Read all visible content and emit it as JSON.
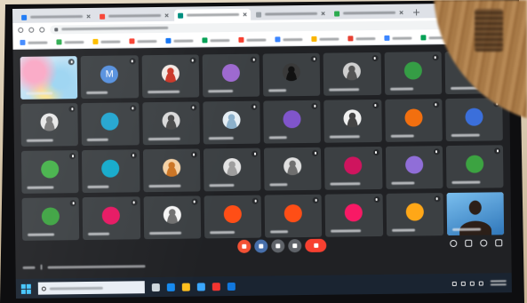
{
  "browser": {
    "tabs": [
      {
        "favicon_color": "#1a73e8",
        "active": false
      },
      {
        "favicon_color": "#ea4335",
        "active": false
      },
      {
        "favicon_color": "#00897b",
        "active": true
      },
      {
        "favicon_color": "#9aa0a6",
        "active": false
      },
      {
        "favicon_color": "#34a853",
        "active": false
      }
    ],
    "extension_colors": [
      "#ea4335",
      "#5f6368",
      "#1a73e8",
      "#ea4335",
      "#5f6368"
    ],
    "bookmark_colors": [
      "#4285f4",
      "#34a853",
      "#fbbc05",
      "#ea4335",
      "#1a73e8",
      "#0f9d58",
      "#ea4335",
      "#4285f4",
      "#f4b400",
      "#db4437",
      "#4285f4",
      "#0f9d58"
    ]
  },
  "meet": {
    "participants": [
      {
        "video": [
          "#f4a9c4",
          "#9fd3ee",
          "#f6e39a",
          "#dcebf5"
        ],
        "speaker": true,
        "muted": true
      },
      {
        "avatar_color": "#5a8fd6",
        "initial": "M",
        "muted": true
      },
      {
        "photo": [
          "#c0392b",
          "#f2e9e4"
        ],
        "muted": true
      },
      {
        "avatar_color": "#9a6bc8",
        "muted": true
      },
      {
        "photo": [
          "#111111",
          "#3a3a3a"
        ],
        "muted": true
      },
      {
        "photo": [
          "#555555",
          "#cfcfcf"
        ],
        "muted": true
      },
      {
        "avatar_color": "#3c9a4a",
        "muted": true
      },
      {
        "avatar_color": "#43a047",
        "muted": true
      },
      {
        "photo": [
          "#777777",
          "#e8e8e8"
        ],
        "muted": true
      },
      {
        "avatar_color": "#2ba3c9",
        "muted": true
      },
      {
        "photo": [
          "#4a4a4a",
          "#d9d9d9"
        ],
        "muted": true
      },
      {
        "photo": [
          "#8fb0c8",
          "#e6eef3"
        ],
        "muted": true
      },
      {
        "avatar_color": "#7e57c2",
        "muted": true
      },
      {
        "photo": [
          "#444444",
          "#f0f0f0"
        ],
        "muted": true
      },
      {
        "avatar_color": "#e8711a",
        "muted": true
      },
      {
        "avatar_color": "#3f6fd1",
        "muted": true
      },
      {
        "avatar_color": "#4caf50",
        "muted": true
      },
      {
        "avatar_color": "#1ea7c5",
        "muted": true
      },
      {
        "photo": [
          "#c4752b",
          "#f2d2a9"
        ],
        "muted": true
      },
      {
        "photo": [
          "#9e9e9e",
          "#e3e3e3"
        ],
        "muted": true
      },
      {
        "photo": [
          "#6f6f6f",
          "#e0e0e0"
        ],
        "muted": true
      },
      {
        "avatar_color": "#c2185b",
        "muted": true
      },
      {
        "avatar_color": "#8e6fd0",
        "muted": true
      },
      {
        "avatar_color": "#43a047",
        "muted": true
      },
      {
        "avatar_color": "#43a047",
        "muted": true
      },
      {
        "avatar_color": "#d81b60",
        "muted": true
      },
      {
        "photo": [
          "#707070",
          "#f5f5f5"
        ],
        "muted": true
      },
      {
        "avatar_color": "#f4511e",
        "muted": true
      },
      {
        "avatar_color": "#f4511e",
        "muted": true
      },
      {
        "avatar_color": "#e91e63",
        "muted": true
      },
      {
        "avatar_color": "#f9a825",
        "muted": true
      },
      {
        "video": [
          "#3576b3",
          "#7fbde8"
        ],
        "person": "#2b1f19",
        "self": true,
        "muted": false
      }
    ],
    "controls": [
      {
        "icon": "mic-off-icon",
        "color": "#e8543a"
      },
      {
        "icon": "camera-icon",
        "color": "#4a6fa5"
      },
      {
        "icon": "captions-icon",
        "color": "#5f6368"
      },
      {
        "icon": "present-icon",
        "color": "#5f6368"
      },
      {
        "icon": "end-call-icon",
        "color": "#ea4335",
        "pill": true
      }
    ],
    "side_icons": [
      "info-icon",
      "people-icon",
      "chat-icon",
      "activities-icon"
    ]
  },
  "taskbar": {
    "start_color": "#4cc2ff",
    "pinned": [
      {
        "icon": "task-view-icon",
        "color": "#cfd8dc"
      },
      {
        "icon": "edge-icon",
        "color": "#1e88e5"
      },
      {
        "icon": "file-explorer-icon",
        "color": "#fbc02d"
      },
      {
        "icon": "store-icon",
        "color": "#42a5f5"
      },
      {
        "icon": "chrome-icon",
        "color": "#e53935"
      },
      {
        "icon": "mail-icon",
        "color": "#1976d2"
      }
    ],
    "tray_icons": [
      "chevron-up-icon",
      "network-icon",
      "volume-icon",
      "battery-icon"
    ]
  }
}
